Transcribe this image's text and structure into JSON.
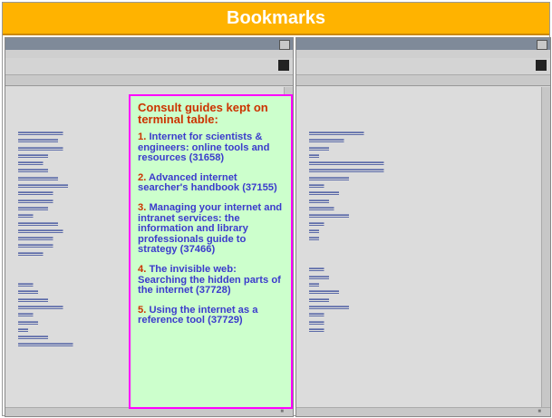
{
  "title": "Bookmarks",
  "guide": {
    "heading": "Consult guides kept on terminal table:",
    "items": [
      {
        "num": "1.",
        "text": " Internet for scientists & engineers: online tools and resources (31658)"
      },
      {
        "num": "2.",
        "text": " Advanced internet searcher's handbook (37155)"
      },
      {
        "num": "3.",
        "text": " Managing your internet and intranet services: the information and library professionals guide to strategy (37466)"
      },
      {
        "num": "4.",
        "text": " The invisible web: Searching the hidden parts of the internet (37728)"
      },
      {
        "num": "5.",
        "text": " Using the internet as a reference tool (37729)"
      }
    ]
  },
  "colors": {
    "title_bar": "#ffb300",
    "guide_bg": "#ccffcc",
    "guide_border": "#ff00ff",
    "guide_numbers": "#cc3300",
    "guide_text": "#3b3bcc"
  }
}
